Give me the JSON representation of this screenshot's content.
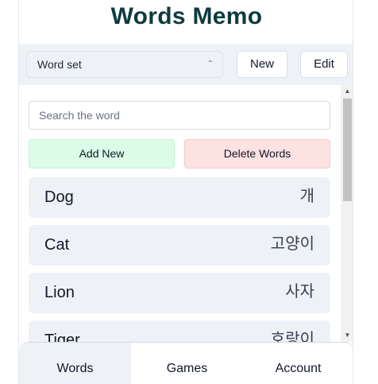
{
  "app": {
    "title": "Words Memo"
  },
  "toolbar": {
    "word_set_select": {
      "value": "Word set",
      "icon": "chevron-updown-icon"
    },
    "new_label": "New",
    "edit_label": "Edit"
  },
  "search": {
    "placeholder": "Search the word"
  },
  "actions": {
    "add_new_label": "Add New",
    "delete_words_label": "Delete Words",
    "add_new_color": "#dcfce7",
    "delete_words_color": "#fde2e2"
  },
  "words": [
    {
      "english": "Dog",
      "korean": "개"
    },
    {
      "english": "Cat",
      "korean": "고양이"
    },
    {
      "english": "Lion",
      "korean": "사자"
    },
    {
      "english": "Tiger",
      "korean": "호랑이"
    }
  ],
  "tabs": [
    {
      "label": "Words",
      "active": true
    },
    {
      "label": "Games",
      "active": false
    },
    {
      "label": "Account",
      "active": false
    }
  ],
  "colors": {
    "title": "#0f3b3e",
    "panel_bg": "#eef2f7"
  }
}
